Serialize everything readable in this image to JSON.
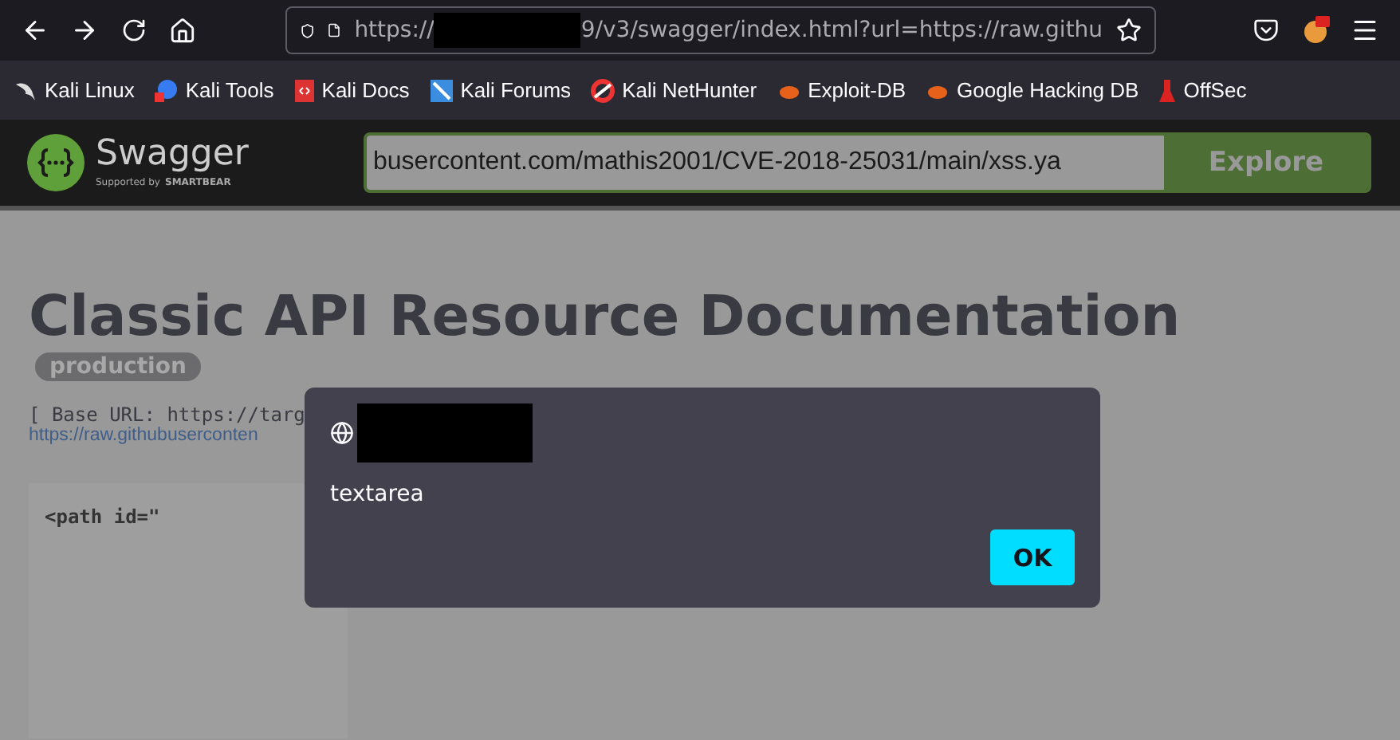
{
  "browser": {
    "url_prefix": "https://",
    "url_rest": "9/v3/swagger/index.html?url=https://raw.githu",
    "bookmarks": [
      {
        "label": "Kali Linux"
      },
      {
        "label": "Kali Tools"
      },
      {
        "label": "Kali Docs"
      },
      {
        "label": "Kali Forums"
      },
      {
        "label": "Kali NetHunter"
      },
      {
        "label": "Exploit-DB"
      },
      {
        "label": "Google Hacking DB"
      },
      {
        "label": "OffSec"
      }
    ]
  },
  "swagger": {
    "logo_text": "Swagger",
    "logo_sub": "Supported by",
    "logo_brand": "SMARTBEAR",
    "spec_url": "busercontent.com/mathis2001/CVE-2018-25031/main/xss.ya",
    "explore_label": "Explore"
  },
  "page": {
    "title": "Classic API Resource Documentation",
    "badge": "production",
    "base_url": "[ Base URL: https://targ",
    "spec_link": "https://raw.githubuserconten",
    "code": "<path id=\""
  },
  "dialog": {
    "message": "textarea",
    "ok_label": "OK"
  }
}
